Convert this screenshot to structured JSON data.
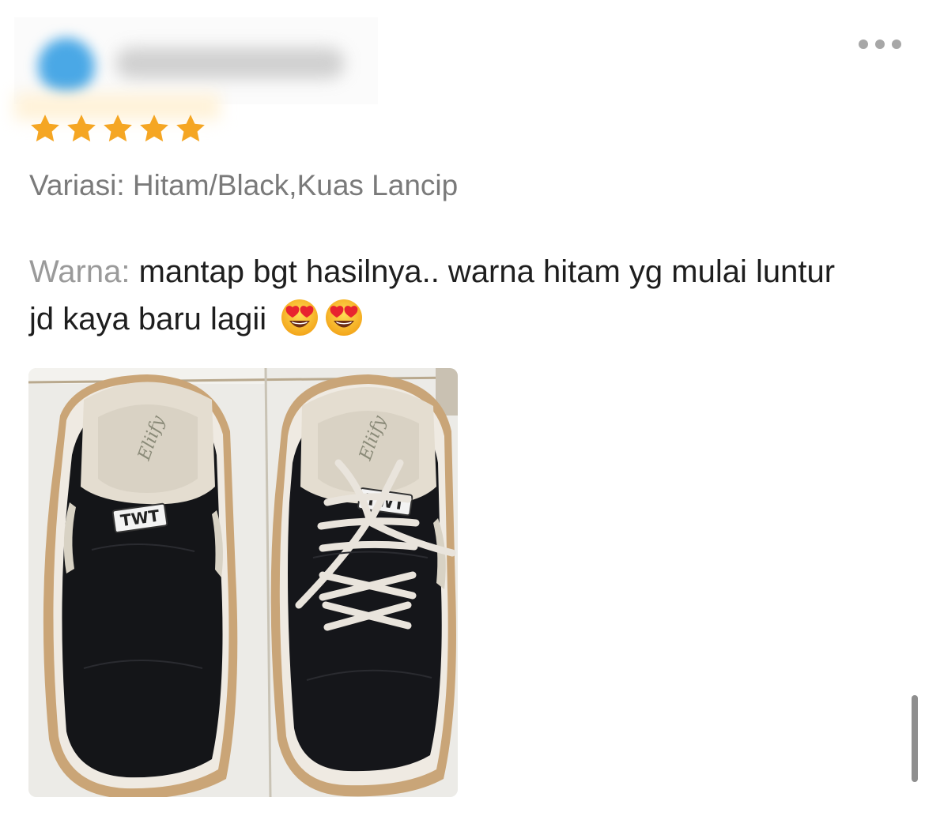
{
  "review": {
    "rating": 5,
    "rating_max": 5,
    "variant": "Variasi: Hitam/Black,Kuas Lancip",
    "text_label": "Warna:",
    "text_body": "mantap bgt hasilnya.. warna hitam yg mulai luntur jd kaya baru lagii",
    "emojis": [
      "heart-eyes",
      "heart-eyes"
    ]
  },
  "photo": {
    "shoe_tag_left": "TWT",
    "shoe_tag_right": "TWT"
  },
  "colors": {
    "star": "#F5A623",
    "avatar": "#4aa8e6"
  },
  "icons": {
    "more": "more-horizontal-icon",
    "star": "star-icon",
    "emoji": "heart-eyes-emoji-icon"
  }
}
